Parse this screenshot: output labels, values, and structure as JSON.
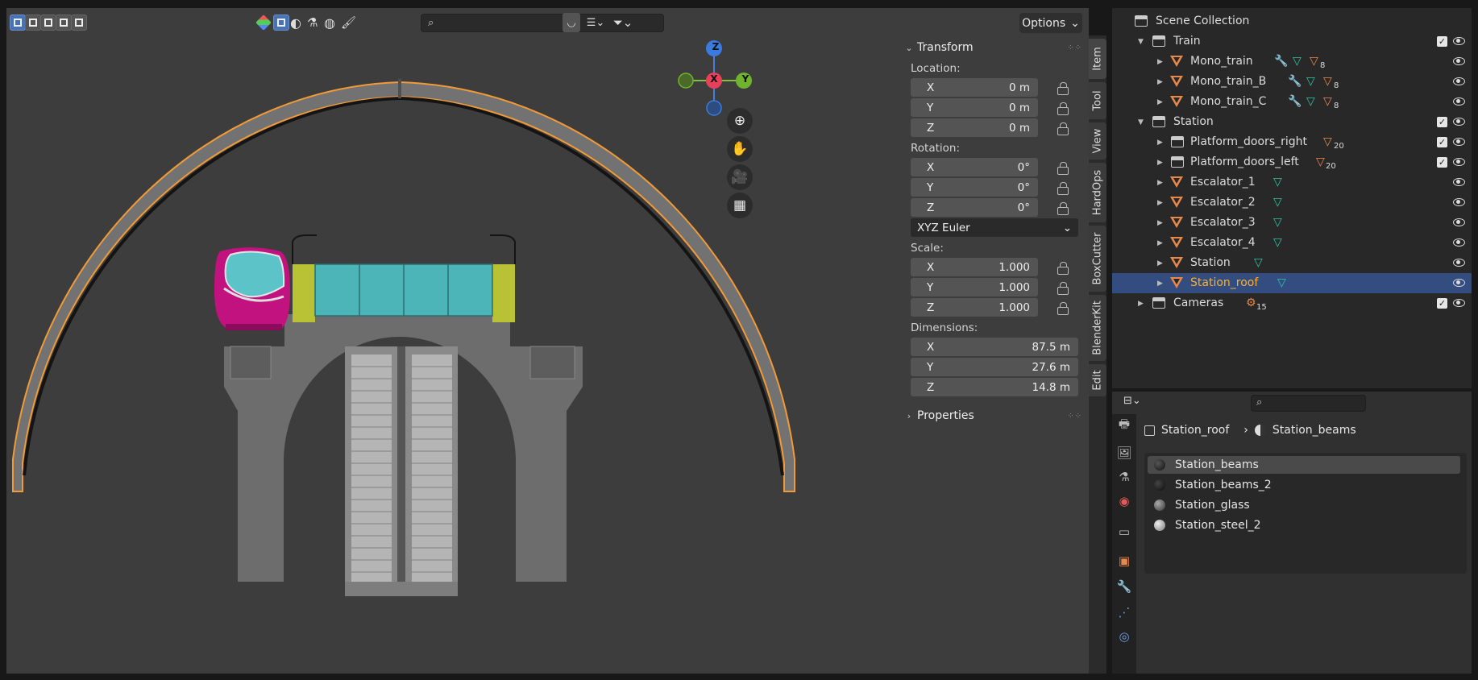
{
  "viewport": {
    "options_label": "Options",
    "search_placeholder": "",
    "gizmo": {
      "x": "X",
      "y": "Y",
      "z": "Z"
    }
  },
  "npanel": {
    "transform_header": "Transform",
    "location_label": "Location:",
    "location": [
      {
        "axis": "X",
        "value": "0 m"
      },
      {
        "axis": "Y",
        "value": "0 m"
      },
      {
        "axis": "Z",
        "value": "0 m"
      }
    ],
    "rotation_label": "Rotation:",
    "rotation": [
      {
        "axis": "X",
        "value": "0°"
      },
      {
        "axis": "Y",
        "value": "0°"
      },
      {
        "axis": "Z",
        "value": "0°"
      }
    ],
    "rotation_mode": "XYZ Euler",
    "scale_label": "Scale:",
    "scale": [
      {
        "axis": "X",
        "value": "1.000"
      },
      {
        "axis": "Y",
        "value": "1.000"
      },
      {
        "axis": "Z",
        "value": "1.000"
      }
    ],
    "dimensions_label": "Dimensions:",
    "dimensions": [
      {
        "axis": "X",
        "value": "87.5 m"
      },
      {
        "axis": "Y",
        "value": "27.6 m"
      },
      {
        "axis": "Z",
        "value": "14.8 m"
      }
    ],
    "properties_header": "Properties"
  },
  "sidebar_tabs": [
    "Item",
    "Tool",
    "View",
    "HardOps",
    "BoxCutter",
    "BlenderKit",
    "Edit"
  ],
  "outliner": {
    "rows": [
      {
        "label": "Scene Collection"
      },
      {
        "label": "Train"
      },
      {
        "label": "Mono_train",
        "count": "8"
      },
      {
        "label": "Mono_train_B",
        "count": "8"
      },
      {
        "label": "Mono_train_C",
        "count": "8"
      },
      {
        "label": "Station"
      },
      {
        "label": "Platform_doors_right",
        "count": "20"
      },
      {
        "label": "Platform_doors_left",
        "count": "20"
      },
      {
        "label": "Escalator_1"
      },
      {
        "label": "Escalator_2"
      },
      {
        "label": "Escalator_3"
      },
      {
        "label": "Escalator_4"
      },
      {
        "label": "Station"
      },
      {
        "label": "Station_roof"
      },
      {
        "label": "Cameras",
        "count": "15"
      }
    ]
  },
  "properties": {
    "breadcrumb_object": "Station_roof",
    "breadcrumb_material": "Station_beams",
    "materials": [
      "Station_beams",
      "Station_beams_2",
      "Station_glass",
      "Station_steel_2"
    ]
  },
  "colors": {
    "selection_orange": "#f29a38",
    "active_blue": "#334d80",
    "train_magenta": "#c2127f",
    "glass_teal": "#4bb5b8",
    "door_yellow": "#b8c234"
  }
}
